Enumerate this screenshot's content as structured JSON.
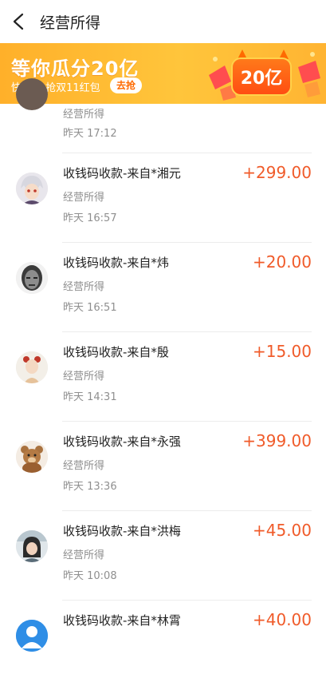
{
  "header": {
    "title": "经营所得"
  },
  "banner": {
    "title": "等你瓜分20亿",
    "subtitle": "快集合 抢双11红包",
    "cta": "去抢",
    "badge": "20亿"
  },
  "transactions": [
    {
      "title": "",
      "category": "经营所得",
      "time": "昨天  17:12",
      "amount": ""
    },
    {
      "title": "收钱码收款-来自*湘元",
      "category": "经营所得",
      "time": "昨天  16:57",
      "amount": "+299.00"
    },
    {
      "title": "收钱码收款-来自*炜",
      "category": "经营所得",
      "time": "昨天  16:51",
      "amount": "+20.00"
    },
    {
      "title": "收钱码收款-来自*殷",
      "category": "经营所得",
      "time": "昨天  14:31",
      "amount": "+15.00"
    },
    {
      "title": "收钱码收款-来自*永强",
      "category": "经营所得",
      "time": "昨天  13:36",
      "amount": "+399.00"
    },
    {
      "title": "收钱码收款-来自*洪梅",
      "category": "经营所得",
      "time": "昨天  10:08",
      "amount": "+45.00"
    },
    {
      "title": "收钱码收款-来自*林霄",
      "category": "",
      "time": "",
      "amount": "+40.00"
    }
  ],
  "colors": {
    "amount": "#f05b2a",
    "banner": "#ffb02a",
    "cta_text": "#ff6a00"
  },
  "icons": {
    "back": "chevron-left-icon"
  }
}
